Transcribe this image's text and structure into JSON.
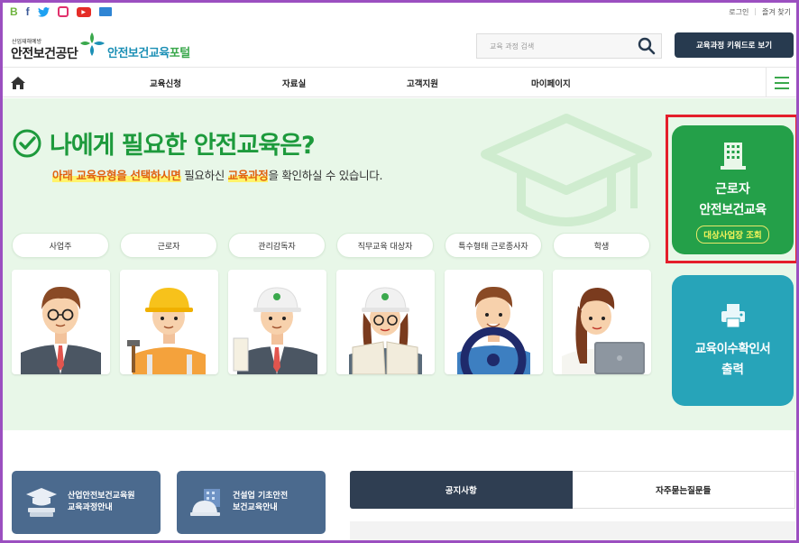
{
  "utility": {
    "sns": [
      "B",
      "f",
      "twitter",
      "instagram",
      "youtube",
      "book"
    ],
    "login": "로그인",
    "separator": "|",
    "favorites": "즐겨 찾기"
  },
  "header": {
    "org_small": "산업재해예방",
    "org_name": "안전보건공단",
    "portal_name_a": "안전보건교육",
    "portal_name_b": "포털",
    "search_placeholder": "교육 과정 검색",
    "keyword_button": "교육과정 키워드로 보기"
  },
  "nav": {
    "items": [
      "교육신청",
      "자료실",
      "고객지원",
      "마이페이지"
    ]
  },
  "hero": {
    "title": "나에게 필요한 안전교육은?",
    "subtitle_hl1": "아래 교육유형을 선택하시면",
    "subtitle_mid": " 필요하신 ",
    "subtitle_hl2": "교육과정",
    "subtitle_tail": "을 확인하실 수 있습니다.",
    "categories": [
      "사업주",
      "근로자",
      "관리감독자",
      "직무교육 대상자",
      "특수형태 근로종사자",
      "학생"
    ]
  },
  "side": {
    "worker_line1": "근로자",
    "worker_line2": "안전보건교육",
    "worker_tag": "대상사업장 조회",
    "cert_line1": "교육이수확인서",
    "cert_line2": "출력"
  },
  "bottom": {
    "guide1_line1": "산업안전보건교육원",
    "guide1_line2": "교육과정안내",
    "guide2_line1": "건설업 기초안전",
    "guide2_line2": "보건교육안내",
    "tab_notice": "공지사항",
    "tab_faq": "자주묻는질문들"
  },
  "colors": {
    "brand_green": "#24a049",
    "teal": "#27a4b9",
    "navy": "#273a4f",
    "hero_bg": "#e8f7e8",
    "highlight": "#e41e2b"
  }
}
